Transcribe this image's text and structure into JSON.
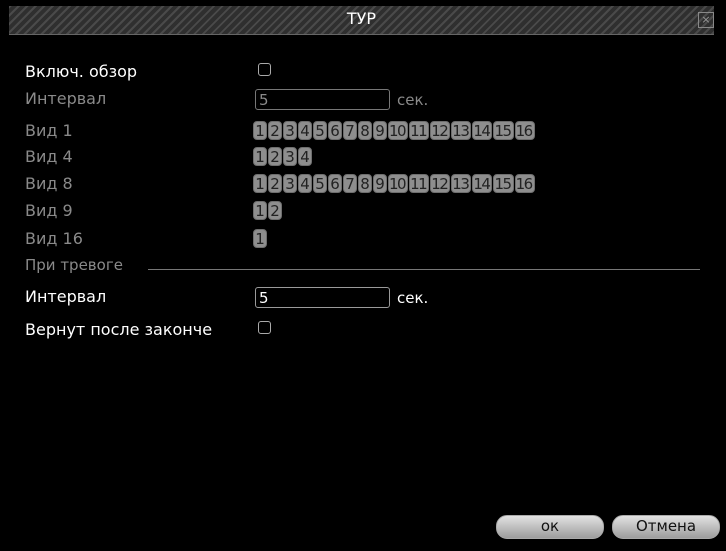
{
  "dialog": {
    "title": "ТУР",
    "close_glyph": "×"
  },
  "tour": {
    "enable_label": "Включ. обзор",
    "interval_label": "Интервал",
    "interval_value": "5",
    "interval_unit": "сек.",
    "views": [
      {
        "label": "Вид 1",
        "channels": [
          "1",
          "2",
          "3",
          "4",
          "5",
          "6",
          "7",
          "8",
          "9",
          "10",
          "11",
          "12",
          "13",
          "14",
          "15",
          "16"
        ]
      },
      {
        "label": "Вид 4",
        "channels": [
          "1",
          "2",
          "3",
          "4"
        ]
      },
      {
        "label": "Вид 8",
        "channels": [
          "1",
          "2",
          "3",
          "4",
          "5",
          "6",
          "7",
          "8",
          "9",
          "10",
          "11",
          "12",
          "13",
          "14",
          "15",
          "16"
        ]
      },
      {
        "label": "Вид 9",
        "channels": [
          "1",
          "2"
        ]
      },
      {
        "label": "Вид 16",
        "channels": [
          "1"
        ]
      }
    ]
  },
  "alarm": {
    "section_label": "При тревоге",
    "interval_label": "Интервал",
    "interval_value": "5",
    "interval_unit": "сек.",
    "return_label": "Вернут после законче"
  },
  "buttons": {
    "ok_label": "ок",
    "cancel_label": "Отмена"
  }
}
